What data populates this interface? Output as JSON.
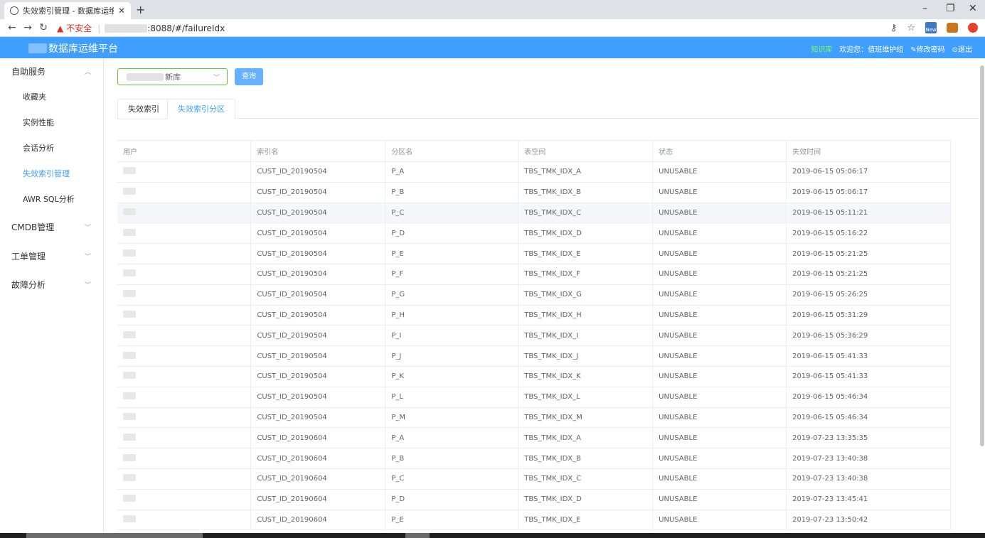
{
  "browser": {
    "tab_title": "失效索引管理 - 数据库运维",
    "url_warning": "不安全",
    "url_suffix": ":8088/#/failureIdx",
    "ext_new_label": "New"
  },
  "header": {
    "title": "数据库运维平台",
    "knowledge": "知识库",
    "welcome": "欢迎您：值班维护组",
    "change_password": "修改密码",
    "logout": "退出"
  },
  "sidebar": {
    "groups": [
      {
        "label": "自助服务",
        "expanded": true
      },
      {
        "label": "CMDB管理",
        "expanded": false
      },
      {
        "label": "工单管理",
        "expanded": false
      },
      {
        "label": "故障分析",
        "expanded": false
      }
    ],
    "sub_items": [
      {
        "label": "收藏夹",
        "active": false
      },
      {
        "label": "实例性能",
        "active": false
      },
      {
        "label": "会话分析",
        "active": false
      },
      {
        "label": "失效索引管理",
        "active": true
      },
      {
        "label": "AWR SQL分析",
        "active": false
      }
    ]
  },
  "filter": {
    "db_select_value": "新库",
    "query_button": "查询"
  },
  "tabs": [
    {
      "label": "失效索引",
      "active": false
    },
    {
      "label": "失效索引分区",
      "active": true
    }
  ],
  "table": {
    "columns": [
      "用户",
      "索引名",
      "分区名",
      "表空间",
      "状态",
      "失效时间"
    ],
    "rows": [
      {
        "index": "CUST_ID_20190504",
        "partition": "P_A",
        "tablespace": "TBS_TMK_IDX_A",
        "status": "UNUSABLE",
        "time": "2019-06-15 05:06:17"
      },
      {
        "index": "CUST_ID_20190504",
        "partition": "P_B",
        "tablespace": "TBS_TMK_IDX_B",
        "status": "UNUSABLE",
        "time": "2019-06-15 05:06:17"
      },
      {
        "index": "CUST_ID_20190504",
        "partition": "P_C",
        "tablespace": "TBS_TMK_IDX_C",
        "status": "UNUSABLE",
        "time": "2019-06-15 05:11:21"
      },
      {
        "index": "CUST_ID_20190504",
        "partition": "P_D",
        "tablespace": "TBS_TMK_IDX_D",
        "status": "UNUSABLE",
        "time": "2019-06-15 05:16:22"
      },
      {
        "index": "CUST_ID_20190504",
        "partition": "P_E",
        "tablespace": "TBS_TMK_IDX_E",
        "status": "UNUSABLE",
        "time": "2019-06-15 05:21:25"
      },
      {
        "index": "CUST_ID_20190504",
        "partition": "P_F",
        "tablespace": "TBS_TMK_IDX_F",
        "status": "UNUSABLE",
        "time": "2019-06-15 05:21:25"
      },
      {
        "index": "CUST_ID_20190504",
        "partition": "P_G",
        "tablespace": "TBS_TMK_IDX_G",
        "status": "UNUSABLE",
        "time": "2019-06-15 05:26:25"
      },
      {
        "index": "CUST_ID_20190504",
        "partition": "P_H",
        "tablespace": "TBS_TMK_IDX_H",
        "status": "UNUSABLE",
        "time": "2019-06-15 05:31:29"
      },
      {
        "index": "CUST_ID_20190504",
        "partition": "P_I",
        "tablespace": "TBS_TMK_IDX_I",
        "status": "UNUSABLE",
        "time": "2019-06-15 05:36:29"
      },
      {
        "index": "CUST_ID_20190504",
        "partition": "P_J",
        "tablespace": "TBS_TMK_IDX_J",
        "status": "UNUSABLE",
        "time": "2019-06-15 05:41:33"
      },
      {
        "index": "CUST_ID_20190504",
        "partition": "P_K",
        "tablespace": "TBS_TMK_IDX_K",
        "status": "UNUSABLE",
        "time": "2019-06-15 05:41:33"
      },
      {
        "index": "CUST_ID_20190504",
        "partition": "P_L",
        "tablespace": "TBS_TMK_IDX_L",
        "status": "UNUSABLE",
        "time": "2019-06-15 05:46:34"
      },
      {
        "index": "CUST_ID_20190504",
        "partition": "P_M",
        "tablespace": "TBS_TMK_IDX_M",
        "status": "UNUSABLE",
        "time": "2019-06-15 05:46:34"
      },
      {
        "index": "CUST_ID_20190604",
        "partition": "P_A",
        "tablespace": "TBS_TMK_IDX_A",
        "status": "UNUSABLE",
        "time": "2019-07-23 13:35:35"
      },
      {
        "index": "CUST_ID_20190604",
        "partition": "P_B",
        "tablespace": "TBS_TMK_IDX_B",
        "status": "UNUSABLE",
        "time": "2019-07-23 13:40:38"
      },
      {
        "index": "CUST_ID_20190604",
        "partition": "P_C",
        "tablespace": "TBS_TMK_IDX_C",
        "status": "UNUSABLE",
        "time": "2019-07-23 13:40:38"
      },
      {
        "index": "CUST_ID_20190604",
        "partition": "P_D",
        "tablespace": "TBS_TMK_IDX_D",
        "status": "UNUSABLE",
        "time": "2019-07-23 13:45:41"
      },
      {
        "index": "CUST_ID_20190604",
        "partition": "P_E",
        "tablespace": "TBS_TMK_IDX_E",
        "status": "UNUSABLE",
        "time": "2019-07-23 13:50:42"
      }
    ]
  }
}
